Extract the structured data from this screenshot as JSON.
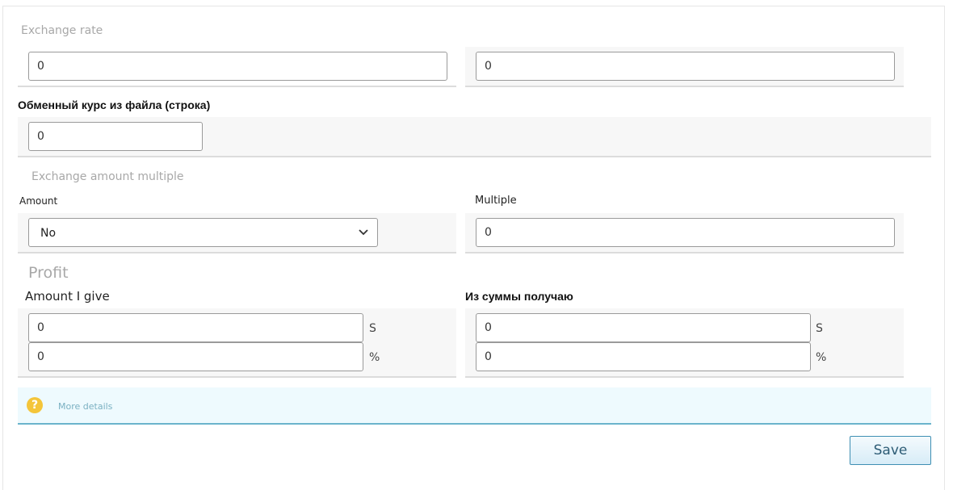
{
  "exchange_rate": {
    "title": "Exchange rate",
    "field_1_value": "0",
    "field_2_value": "0"
  },
  "file_rate": {
    "label": "Обменный курс из файла (строка)",
    "value": "0"
  },
  "amount_multiple": {
    "title": "Exchange amount multiple",
    "amount_label": "Amount",
    "amount_selected": "No",
    "multiple_label": "Multiple",
    "multiple_value": "0"
  },
  "profit": {
    "title": "Profit",
    "give_label": "Amount I give",
    "give_amount": "0",
    "give_amount_unit": "S",
    "give_percent": "0",
    "give_percent_unit": "%",
    "receive_label": "Из суммы получаю",
    "receive_amount": "0",
    "receive_amount_unit": "S",
    "receive_percent": "0",
    "receive_percent_unit": "%"
  },
  "info": {
    "icon": "question-icon",
    "icon_glyph": "?",
    "link_text": "More details"
  },
  "actions": {
    "save_label": "Save"
  },
  "colors": {
    "info_background": "#eefafe",
    "info_border": "#6bb4cc",
    "help_icon": "#f4c53a",
    "save_border": "#3f8fb3"
  }
}
